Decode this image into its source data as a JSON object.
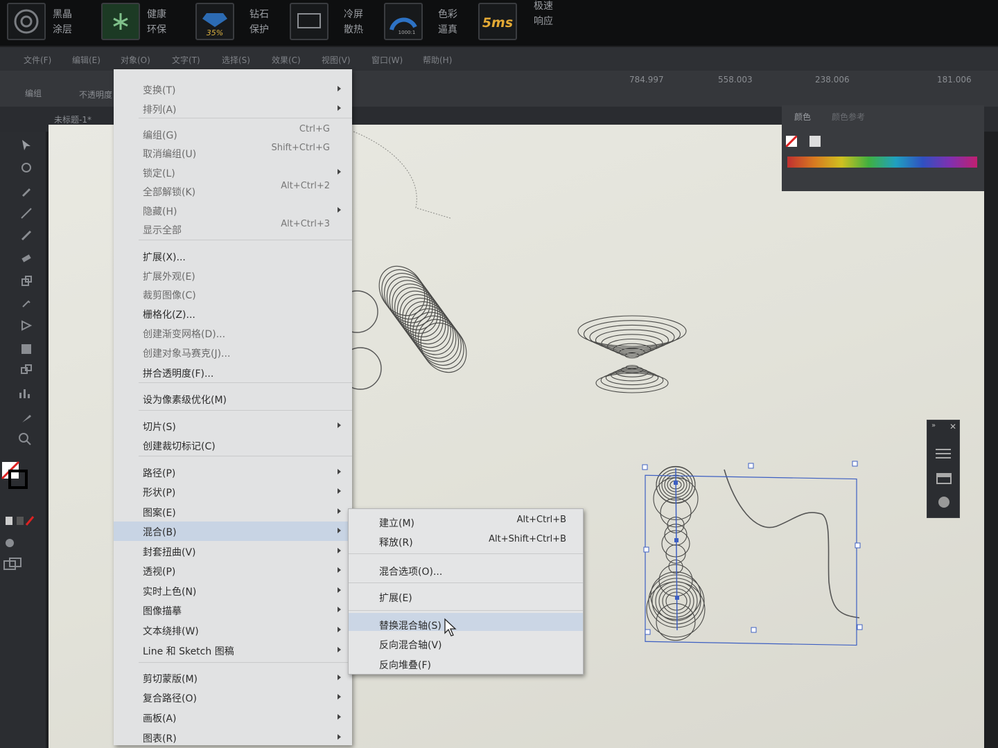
{
  "monitor_badges": [
    {
      "line1": "黑晶",
      "line2": "涂层",
      "icon": "disc-logo-icon"
    },
    {
      "line1": "健康",
      "line2": "环保",
      "icon": "leaf-logo-icon"
    },
    {
      "line1": "钻石",
      "line2": "保护",
      "icon": "diamond-logo-icon",
      "icon_text": "35%"
    },
    {
      "line1": "冷屏",
      "line2": "散热",
      "icon": "monitor-logo-icon"
    },
    {
      "line1": "色彩",
      "line2": "逼真",
      "icon": "gauge-logo-icon",
      "icon_text": "1000:1"
    },
    {
      "line1": "极速",
      "line2": "响应",
      "icon": "response-logo-icon",
      "icon_text": "5ms"
    }
  ],
  "menubar": {
    "items": [
      "文件(F)",
      "编辑(E)",
      "对象(O)",
      "文字(T)",
      "选择(S)",
      "效果(C)",
      "视图(V)",
      "窗口(W)",
      "帮助(H)"
    ]
  },
  "controlbar": {
    "x_value": "784.997",
    "y_value": "558.003",
    "w_value": "238.006",
    "h_value": "181.006",
    "left_label": "不透明度",
    "obj_label": "编组"
  },
  "document_tab": {
    "title": "未标题-1*"
  },
  "color_panel": {
    "tab1": "颜色",
    "tab2": "颜色参考"
  },
  "object_menu": {
    "groups": [
      [
        {
          "label": "变换(T)",
          "submenu": true,
          "disabled": true
        },
        {
          "label": "排列(A)",
          "submenu": true,
          "disabled": true
        }
      ],
      [
        {
          "label": "编组(G)",
          "shortcut": "Ctrl+G",
          "disabled": true
        },
        {
          "label": "取消编组(U)",
          "shortcut": "Shift+Ctrl+G",
          "disabled": true
        },
        {
          "label": "锁定(L)",
          "submenu": true,
          "disabled": true
        },
        {
          "label": "全部解锁(K)",
          "shortcut": "Alt+Ctrl+2",
          "disabled": true
        },
        {
          "label": "隐藏(H)",
          "submenu": true,
          "disabled": true
        },
        {
          "label": "显示全部",
          "shortcut": "Alt+Ctrl+3",
          "disabled": true
        }
      ],
      [
        {
          "label": "扩展(X)..."
        },
        {
          "label": "扩展外观(E)",
          "disabled": true
        },
        {
          "label": "裁剪图像(C)",
          "disabled": true
        },
        {
          "label": "栅格化(Z)..."
        },
        {
          "label": "创建渐变网格(D)...",
          "disabled": true
        },
        {
          "label": "创建对象马赛克(J)...",
          "disabled": true
        },
        {
          "label": "拼合透明度(F)..."
        }
      ],
      [
        {
          "label": "设为像素级优化(M)"
        }
      ],
      [
        {
          "label": "切片(S)",
          "submenu": true
        },
        {
          "label": "创建裁切标记(C)"
        }
      ],
      [
        {
          "label": "路径(P)",
          "submenu": true
        },
        {
          "label": "形状(P)",
          "submenu": true
        },
        {
          "label": "图案(E)",
          "submenu": true
        },
        {
          "label": "混合(B)",
          "submenu": true,
          "highlighted": true
        },
        {
          "label": "封套扭曲(V)",
          "submenu": true
        },
        {
          "label": "透视(P)",
          "submenu": true
        },
        {
          "label": "实时上色(N)",
          "submenu": true
        },
        {
          "label": "图像描摹",
          "submenu": true
        },
        {
          "label": "文本绕排(W)",
          "submenu": true
        },
        {
          "label": "Line 和 Sketch 图稿",
          "submenu": true
        }
      ],
      [
        {
          "label": "剪切蒙版(M)",
          "submenu": true
        },
        {
          "label": "复合路径(O)",
          "submenu": true
        },
        {
          "label": "画板(A)",
          "submenu": true
        },
        {
          "label": "图表(R)",
          "submenu": true
        }
      ]
    ]
  },
  "blend_submenu": {
    "items": [
      {
        "label": "建立(M)",
        "shortcut": "Alt+Ctrl+B"
      },
      {
        "label": "释放(R)",
        "shortcut": "Alt+Shift+Ctrl+B"
      },
      {
        "label": "混合选项(O)..."
      },
      {
        "label": "扩展(E)"
      },
      {
        "label": "替换混合轴(S)",
        "highlighted": true
      },
      {
        "label": "反向混合轴(V)"
      },
      {
        "label": "反向堆叠(F)"
      }
    ]
  }
}
